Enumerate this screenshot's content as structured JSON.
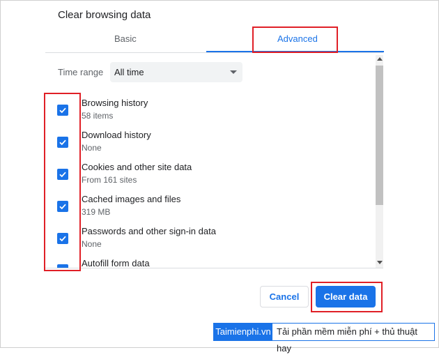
{
  "dialog": {
    "title": "Clear browsing data",
    "tabs": [
      {
        "label": "Basic",
        "selected": false
      },
      {
        "label": "Advanced",
        "selected": true
      }
    ],
    "time_range": {
      "label": "Time range",
      "value": "All time"
    },
    "items": [
      {
        "title": "Browsing history",
        "subtitle": "58 items",
        "checked": true
      },
      {
        "title": "Download history",
        "subtitle": "None",
        "checked": true
      },
      {
        "title": "Cookies and other site data",
        "subtitle": "From 161 sites",
        "checked": true
      },
      {
        "title": "Cached images and files",
        "subtitle": "319 MB",
        "checked": true
      },
      {
        "title": "Passwords and other sign-in data",
        "subtitle": "None",
        "checked": true
      },
      {
        "title": "Autofill form data",
        "subtitle": "",
        "checked": true
      }
    ],
    "buttons": {
      "cancel": "Cancel",
      "clear": "Clear data"
    }
  },
  "watermark": {
    "brand": "Taimienphi.vn",
    "tagline": "Tải phần mềm miễn phí + thủ thuật hay"
  },
  "colors": {
    "accent": "#1a73e8",
    "highlight": "#e01f26"
  }
}
